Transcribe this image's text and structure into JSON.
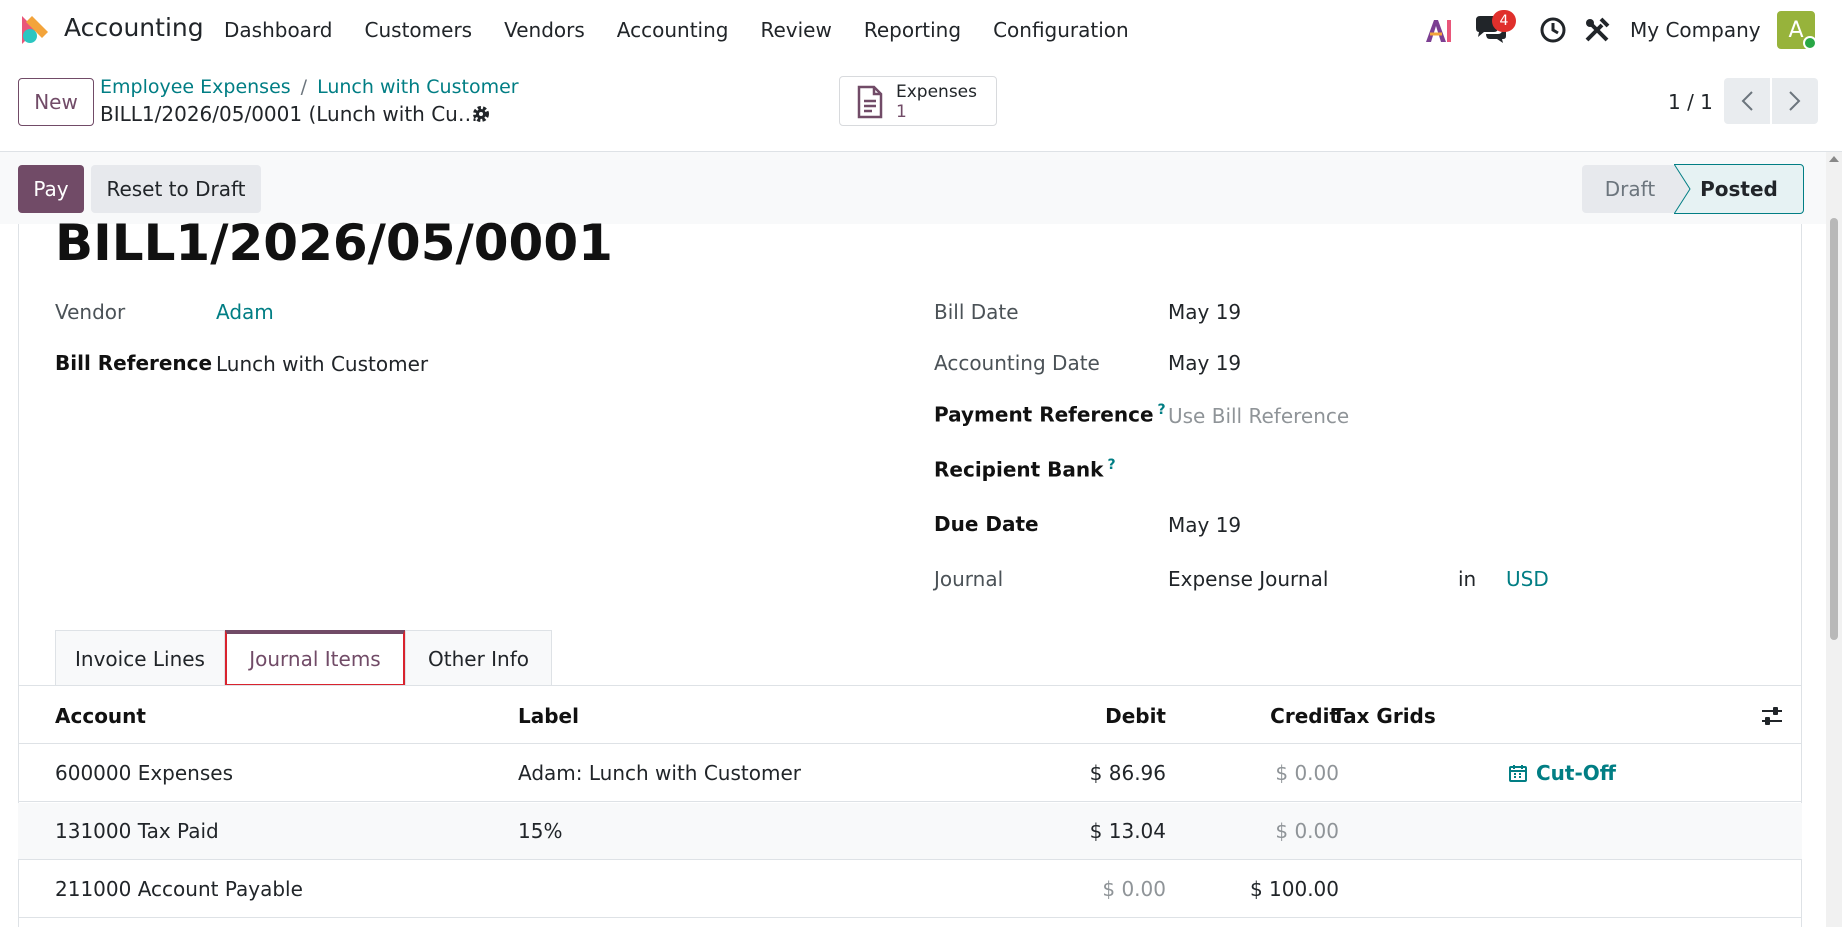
{
  "nav": {
    "app_name": "Accounting",
    "menu": [
      "Dashboard",
      "Customers",
      "Vendors",
      "Accounting",
      "Review",
      "Reporting",
      "Configuration"
    ],
    "notifications": "4",
    "company": "My Company",
    "avatar_letter": "A"
  },
  "control": {
    "new_label": "New",
    "breadcrumb": [
      "Employee Expenses",
      "Lunch with Customer"
    ],
    "record_name": "BILL1/2026/05/0001 (Lunch with Cu…",
    "smart_button": {
      "label": "Expenses",
      "value": "1"
    },
    "pager": "1 / 1"
  },
  "status": {
    "pay_label": "Pay",
    "reset_label": "Reset to Draft",
    "stages": [
      "Draft",
      "Posted"
    ],
    "current_stage": "Posted"
  },
  "form": {
    "title": "BILL1/2026/05/0001",
    "vendor_label": "Vendor",
    "vendor_value": "Adam",
    "bill_ref_label": "Bill Reference",
    "bill_ref_value": "Lunch with Customer",
    "bill_date_label": "Bill Date",
    "bill_date_value": "May 19",
    "acc_date_label": "Accounting Date",
    "acc_date_value": "May 19",
    "pay_ref_label": "Payment Reference",
    "pay_ref_placeholder": "Use Bill Reference",
    "recipient_bank_label": "Recipient Bank",
    "due_date_label": "Due Date",
    "due_date_value": "May 19",
    "journal_label": "Journal",
    "journal_value": "Expense Journal",
    "in_label": "in",
    "currency": "USD",
    "help_mark": "?"
  },
  "tabs": [
    "Invoice Lines",
    "Journal Items",
    "Other Info"
  ],
  "table": {
    "headers": [
      "Account",
      "Label",
      "Debit",
      "Credit",
      "Tax Grids"
    ],
    "rows": [
      {
        "account": "600000 Expenses",
        "label": "Adam: Lunch with Customer",
        "debit": "$ 86.96",
        "credit": "$ 0.00",
        "action": "Cut-Off"
      },
      {
        "account": "131000 Tax Paid",
        "label": "15%",
        "debit": "$ 13.04",
        "credit": "$ 0.00"
      },
      {
        "account": "211000 Account Payable",
        "label": "",
        "debit": "$ 0.00",
        "credit": "$ 100.00"
      }
    ]
  },
  "colors": {
    "brand": "#714b67",
    "link": "#017e84",
    "highlight": "#d9232e"
  }
}
